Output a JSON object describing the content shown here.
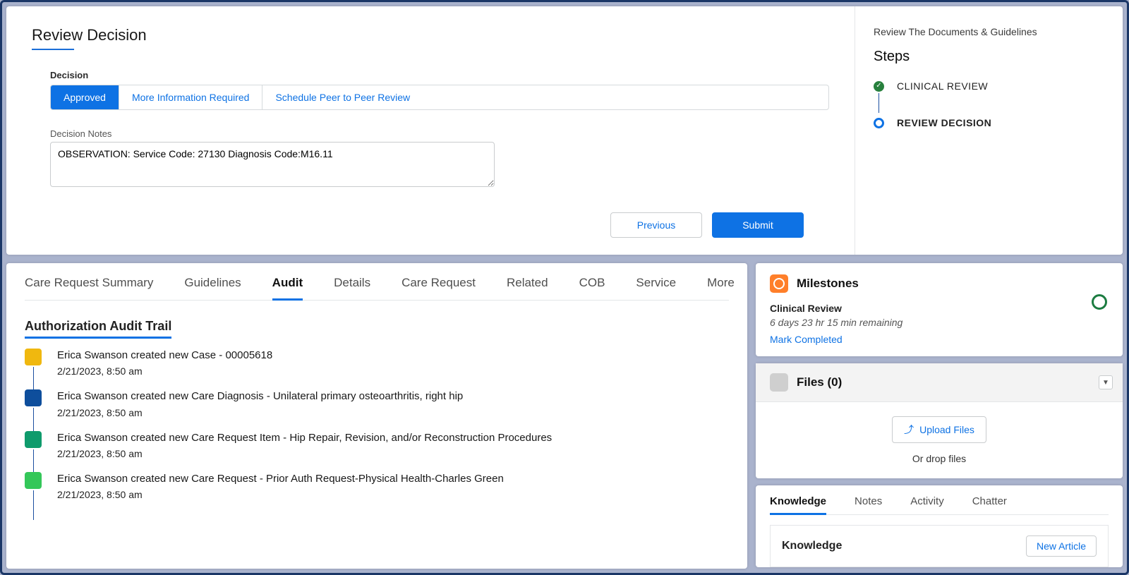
{
  "review": {
    "title": "Review Decision",
    "decision_label": "Decision",
    "options": {
      "approved": "Approved",
      "more_info": "More Information Required",
      "schedule_p2p": "Schedule Peer to Peer Review"
    },
    "notes_label": "Decision Notes",
    "notes_value": "OBSERVATION: Service Code: 27130 Diagnosis Code:M16.11",
    "previous": "Previous",
    "submit": "Submit"
  },
  "sidebar": {
    "heading": "Review The Documents & Guidelines",
    "steps_label": "Steps",
    "step1": "CLINICAL REVIEW",
    "step2": "REVIEW DECISION"
  },
  "tabs": {
    "care_request_summary": "Care Request Summary",
    "guidelines": "Guidelines",
    "audit": "Audit",
    "details": "Details",
    "care_request": "Care Request",
    "related": "Related",
    "cob": "COB",
    "service": "Service",
    "more": "More"
  },
  "audit": {
    "heading": "Authorization Audit Trail",
    "items": [
      {
        "icon_color": "#f0b80f",
        "text": "Erica Swanson created new Case - 00005618",
        "date": "2/21/2023, 8:50 am"
      },
      {
        "icon_color": "#0e4e9c",
        "text": "Erica Swanson created new Care Diagnosis - Unilateral primary osteoarthritis, right hip",
        "date": "2/21/2023, 8:50 am"
      },
      {
        "icon_color": "#0f9b6c",
        "text": "Erica Swanson created new Care Request Item - Hip Repair, Revision, and/or Reconstruction Procedures",
        "date": "2/21/2023, 8:50 am"
      },
      {
        "icon_color": "#34c759",
        "text": "Erica Swanson created new Care Request - Prior Auth Request-Physical Health-Charles Green",
        "date": "2/21/2023, 8:50 am"
      }
    ]
  },
  "milestones": {
    "title": "Milestones",
    "name": "Clinical Review",
    "remaining": "6 days 23 hr 15 min remaining",
    "mark_completed": "Mark Completed"
  },
  "files": {
    "title": "Files (0)",
    "upload": "Upload Files",
    "drop": "Or drop files"
  },
  "knowledge": {
    "tabs": {
      "knowledge": "Knowledge",
      "notes": "Notes",
      "activity": "Activity",
      "chatter": "Chatter"
    },
    "body_title": "Knowledge",
    "new_article": "New Article"
  }
}
